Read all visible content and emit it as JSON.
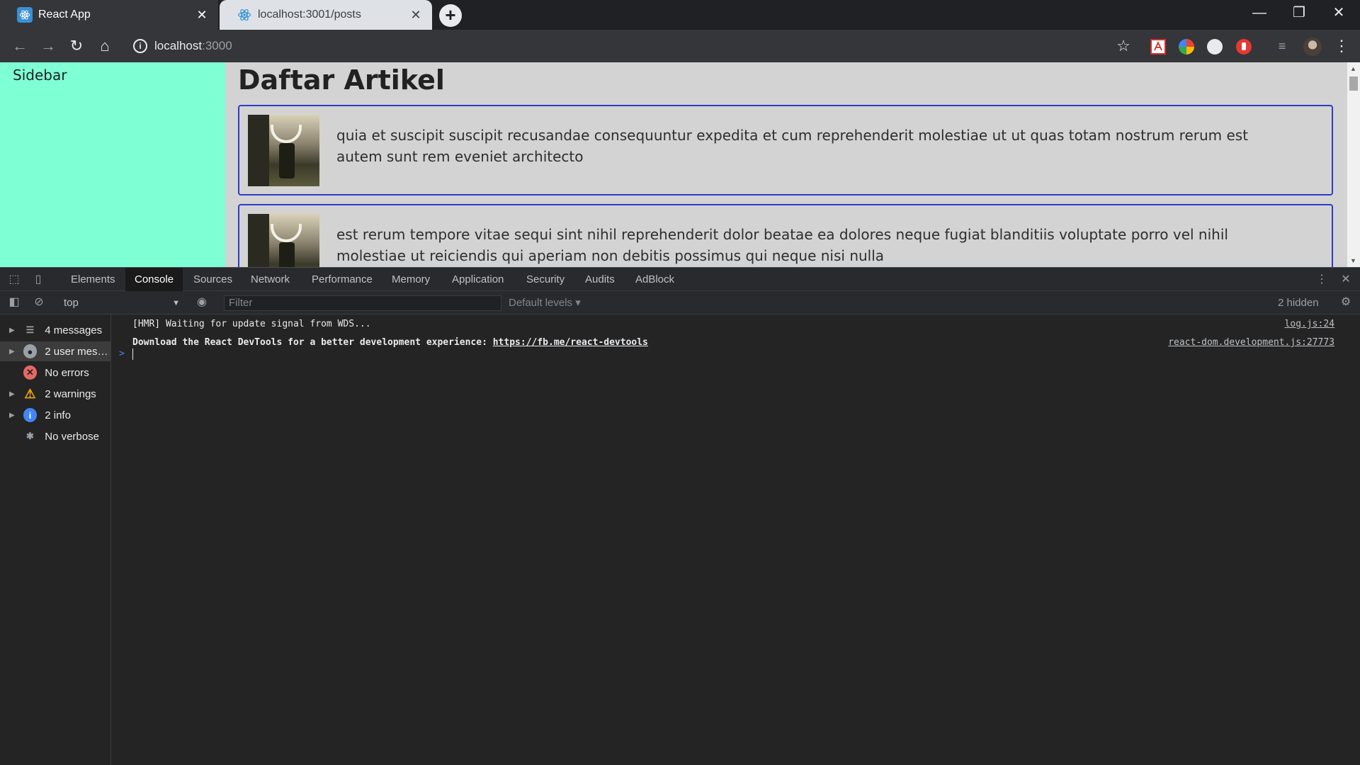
{
  "browser": {
    "tabs": [
      {
        "title": "React App",
        "active": true
      },
      {
        "title": "localhost:3001/posts",
        "active": false
      }
    ],
    "new_tab": "+",
    "window_controls": {
      "minimize": "—",
      "restore": "❐",
      "close": "✕"
    },
    "address": {
      "host": "localhost",
      "port": ":3000"
    },
    "nav": {
      "back": "←",
      "forward": "→",
      "reload": "↻",
      "home": "⌂"
    },
    "star": "☆",
    "menu": "⋮"
  },
  "page": {
    "sidebar_title": "Sidebar",
    "heading": "Daftar Artikel",
    "articles": [
      {
        "text": "quia et suscipit suscipit recusandae consequuntur expedita et cum reprehenderit molestiae ut ut quas totam nostrum rerum est autem sunt rem eveniet architecto"
      },
      {
        "text": "est rerum tempore vitae sequi sint nihil reprehenderit dolor beatae ea dolores neque fugiat blanditiis voluptate porro vel nihil molestiae ut reiciendis qui aperiam non debitis possimus qui neque nisi nulla"
      }
    ]
  },
  "devtools": {
    "tabs": [
      "Elements",
      "Console",
      "Sources",
      "Network",
      "Performance",
      "Memory",
      "Application",
      "Security",
      "Audits",
      "AdBlock"
    ],
    "active_tab": "Console",
    "context": "top",
    "filter_placeholder": "Filter",
    "levels": "Default levels ▾",
    "hidden": "2 hidden",
    "sidebar": [
      {
        "label": "4 messages",
        "icon": "list-icon",
        "expandable": true
      },
      {
        "label": "2 user mess...",
        "icon": "user-icon",
        "expandable": true
      },
      {
        "label": "No errors",
        "icon": "error-icon",
        "expandable": false
      },
      {
        "label": "2 warnings",
        "icon": "warning-icon",
        "expandable": true
      },
      {
        "label": "2 info",
        "icon": "info-icon",
        "expandable": true
      },
      {
        "label": "No verbose",
        "icon": "bug-icon",
        "expandable": false
      }
    ],
    "messages": [
      {
        "text": "[HMR] Waiting for update signal from WDS...",
        "source": "log.js:24"
      },
      {
        "text": "Download the React DevTools for a better development experience: ",
        "link": "https://fb.me/react-devtools",
        "source": "react-dom.development.js:27773"
      }
    ],
    "prompt": ">"
  },
  "colors": {
    "sidebar_bg": "#7fffd4",
    "page_bg": "#d3d3d3",
    "card_border": "#2f3cc4",
    "devtools_bg": "#242424"
  }
}
